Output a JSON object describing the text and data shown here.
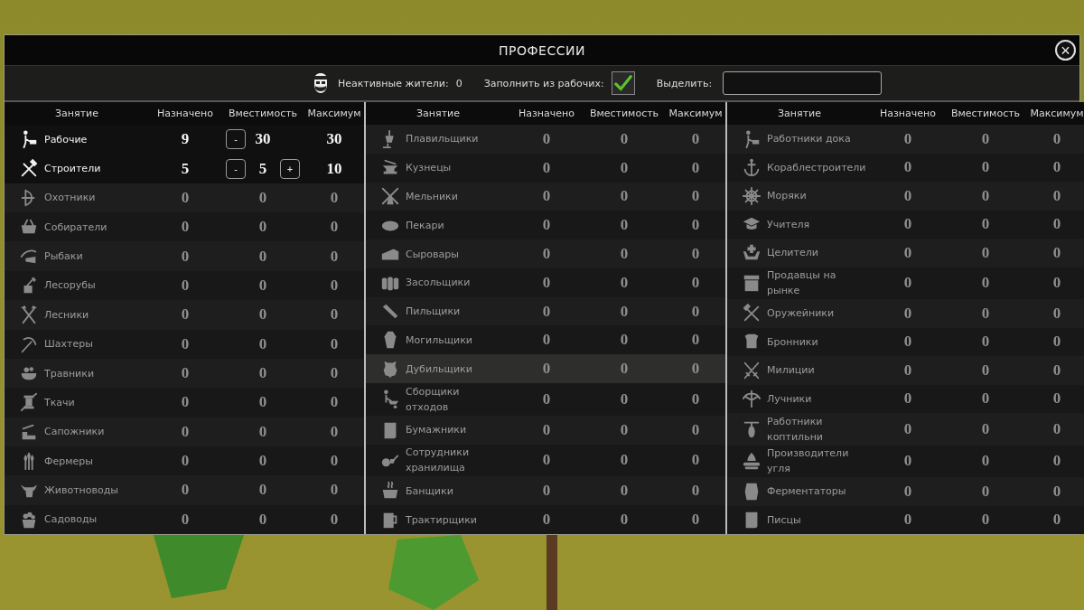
{
  "window": {
    "title": "ПРОФЕССИИ",
    "close": "×"
  },
  "toolbar": {
    "idle_label": "Неактивные жители:",
    "idle_count": "0",
    "fill_label": "Заполнить из рабочих:",
    "fill_checked": true,
    "highlight_label": "Выделить:"
  },
  "tables": [
    {
      "columns": [
        "Занятие",
        "Назначено",
        "Вместимость",
        "Максимум"
      ],
      "rows": [
        {
          "name": "Рабочие",
          "assigned": "9",
          "capacity": "30",
          "maximum": "30",
          "active": true,
          "selected": false,
          "decrease": "-"
        },
        {
          "name": "Строители",
          "assigned": "5",
          "capacity": "5",
          "maximum": "10",
          "active": true,
          "selected": false,
          "decrease": "-",
          "increase": "+"
        },
        {
          "name": "Охотники",
          "assigned": "0",
          "capacity": "0",
          "maximum": "0",
          "active": false,
          "selected": false
        },
        {
          "name": "Собиратели",
          "assigned": "0",
          "capacity": "0",
          "maximum": "0",
          "active": false,
          "selected": false
        },
        {
          "name": "Рыбаки",
          "assigned": "0",
          "capacity": "0",
          "maximum": "0",
          "active": false,
          "selected": false
        },
        {
          "name": "Лесорубы",
          "assigned": "0",
          "capacity": "0",
          "maximum": "0",
          "active": false,
          "selected": false
        },
        {
          "name": "Лесники",
          "assigned": "0",
          "capacity": "0",
          "maximum": "0",
          "active": false,
          "selected": false
        },
        {
          "name": "Шахтеры",
          "assigned": "0",
          "capacity": "0",
          "maximum": "0",
          "active": false,
          "selected": false
        },
        {
          "name": "Травники",
          "assigned": "0",
          "capacity": "0",
          "maximum": "0",
          "active": false,
          "selected": false
        },
        {
          "name": "Ткачи",
          "assigned": "0",
          "capacity": "0",
          "maximum": "0",
          "active": false,
          "selected": false
        },
        {
          "name": "Сапожники",
          "assigned": "0",
          "capacity": "0",
          "maximum": "0",
          "active": false,
          "selected": false
        },
        {
          "name": "Фермеры",
          "assigned": "0",
          "capacity": "0",
          "maximum": "0",
          "active": false,
          "selected": false
        },
        {
          "name": "Животноводы",
          "assigned": "0",
          "capacity": "0",
          "maximum": "0",
          "active": false,
          "selected": false
        },
        {
          "name": "Садоводы",
          "assigned": "0",
          "capacity": "0",
          "maximum": "0",
          "active": false,
          "selected": false
        }
      ]
    },
    {
      "columns": [
        "Занятие",
        "Назначено",
        "Вместимость",
        "Максимум"
      ],
      "rows": [
        {
          "name": "Плавильщики",
          "assigned": "0",
          "capacity": "0",
          "maximum": "0",
          "active": false,
          "selected": false
        },
        {
          "name": "Кузнецы",
          "assigned": "0",
          "capacity": "0",
          "maximum": "0",
          "active": false,
          "selected": false
        },
        {
          "name": "Мельники",
          "assigned": "0",
          "capacity": "0",
          "maximum": "0",
          "active": false,
          "selected": false
        },
        {
          "name": "Пекари",
          "assigned": "0",
          "capacity": "0",
          "maximum": "0",
          "active": false,
          "selected": false
        },
        {
          "name": "Сыровары",
          "assigned": "0",
          "capacity": "0",
          "maximum": "0",
          "active": false,
          "selected": false
        },
        {
          "name": "Засольщики",
          "assigned": "0",
          "capacity": "0",
          "maximum": "0",
          "active": false,
          "selected": false
        },
        {
          "name": "Пильщики",
          "assigned": "0",
          "capacity": "0",
          "maximum": "0",
          "active": false,
          "selected": false
        },
        {
          "name": "Могильщики",
          "assigned": "0",
          "capacity": "0",
          "maximum": "0",
          "active": false,
          "selected": false
        },
        {
          "name": "Дубильщики",
          "assigned": "0",
          "capacity": "0",
          "maximum": "0",
          "active": false,
          "selected": true
        },
        {
          "name": "Сборщики отходов",
          "assigned": "0",
          "capacity": "0",
          "maximum": "0",
          "active": false,
          "selected": false
        },
        {
          "name": "Бумажники",
          "assigned": "0",
          "capacity": "0",
          "maximum": "0",
          "active": false,
          "selected": false
        },
        {
          "name": "Сотрудники хранилища",
          "assigned": "0",
          "capacity": "0",
          "maximum": "0",
          "active": false,
          "selected": false
        },
        {
          "name": "Банщики",
          "assigned": "0",
          "capacity": "0",
          "maximum": "0",
          "active": false,
          "selected": false
        },
        {
          "name": "Трактирщики",
          "assigned": "0",
          "capacity": "0",
          "maximum": "0",
          "active": false,
          "selected": false
        }
      ]
    },
    {
      "columns": [
        "Занятие",
        "Назначено",
        "Вместимость",
        "Максимум"
      ],
      "rows": [
        {
          "name": "Работники дока",
          "assigned": "0",
          "capacity": "0",
          "maximum": "0",
          "active": false,
          "selected": false
        },
        {
          "name": "Кораблестроители",
          "assigned": "0",
          "capacity": "0",
          "maximum": "0",
          "active": false,
          "selected": false
        },
        {
          "name": "Моряки",
          "assigned": "0",
          "capacity": "0",
          "maximum": "0",
          "active": false,
          "selected": false
        },
        {
          "name": "Учителя",
          "assigned": "0",
          "capacity": "0",
          "maximum": "0",
          "active": false,
          "selected": false
        },
        {
          "name": "Целители",
          "assigned": "0",
          "capacity": "0",
          "maximum": "0",
          "active": false,
          "selected": false
        },
        {
          "name": "Продавцы на рынке",
          "assigned": "0",
          "capacity": "0",
          "maximum": "0",
          "active": false,
          "selected": false
        },
        {
          "name": "Оружейники",
          "assigned": "0",
          "capacity": "0",
          "maximum": "0",
          "active": false,
          "selected": false
        },
        {
          "name": "Бронники",
          "assigned": "0",
          "capacity": "0",
          "maximum": "0",
          "active": false,
          "selected": false
        },
        {
          "name": "Милиции",
          "assigned": "0",
          "capacity": "0",
          "maximum": "0",
          "active": false,
          "selected": false
        },
        {
          "name": "Лучники",
          "assigned": "0",
          "capacity": "0",
          "maximum": "0",
          "active": false,
          "selected": false
        },
        {
          "name": "Работники коптильни",
          "assigned": "0",
          "capacity": "0",
          "maximum": "0",
          "active": false,
          "selected": false
        },
        {
          "name": "Производители угля",
          "assigned": "0",
          "capacity": "0",
          "maximum": "0",
          "active": false,
          "selected": false
        },
        {
          "name": "Ферментаторы",
          "assigned": "0",
          "capacity": "0",
          "maximum": "0",
          "active": false,
          "selected": false
        },
        {
          "name": "Писцы",
          "assigned": "0",
          "capacity": "0",
          "maximum": "0",
          "active": false,
          "selected": false
        }
      ]
    }
  ]
}
